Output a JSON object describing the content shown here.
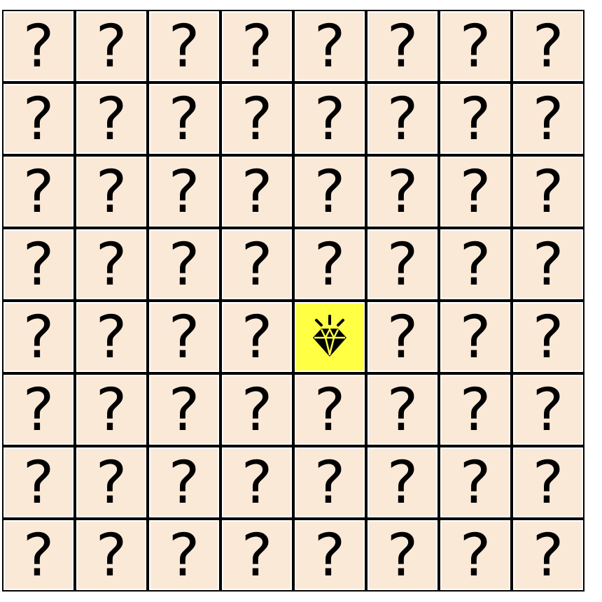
{
  "board": {
    "rows": 8,
    "cols": 8,
    "hidden_symbol": "?",
    "hidden_icon": "question-mark-icon",
    "hidden_color": "#fbe9d7",
    "revealed": [
      {
        "row": 4,
        "col": 4,
        "icon": "diamond-icon",
        "color": "#ffff44"
      }
    ]
  }
}
